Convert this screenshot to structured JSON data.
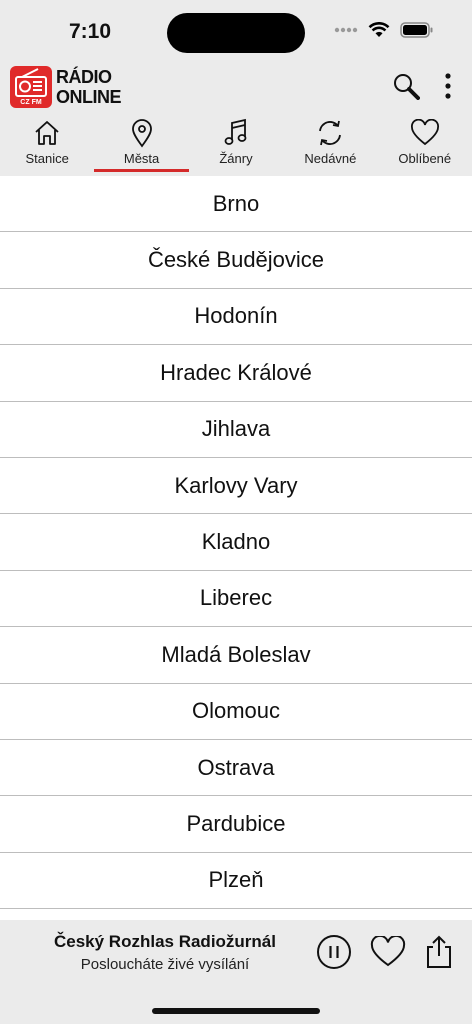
{
  "status": {
    "time": "7:10"
  },
  "app": {
    "logo_line1": "RÁDIO",
    "logo_line2": "ONLINE",
    "logo_badge": "CZ FM"
  },
  "tabs": [
    {
      "label": "Stanice",
      "icon": "home-icon"
    },
    {
      "label": "Města",
      "icon": "location-pin-icon",
      "active": true
    },
    {
      "label": "Žánry",
      "icon": "music-note-icon"
    },
    {
      "label": "Nedávné",
      "icon": "refresh-icon"
    },
    {
      "label": "Oblíbené",
      "icon": "heart-icon"
    }
  ],
  "cities": [
    "Brno",
    "České Budějovice",
    "Hodonín",
    "Hradec Králové",
    "Jihlava",
    "Karlovy Vary",
    "Kladno",
    "Liberec",
    "Mladá Boleslav",
    "Olomouc",
    "Ostrava",
    "Pardubice",
    "Plzeň"
  ],
  "player": {
    "title": "Český Rozhlas Radiožurnál",
    "subtitle": "Posloucháte živé vysílání"
  },
  "colors": {
    "accent": "#d42a2a",
    "logo": "#e02a2a",
    "bar": "#ebebeb"
  }
}
